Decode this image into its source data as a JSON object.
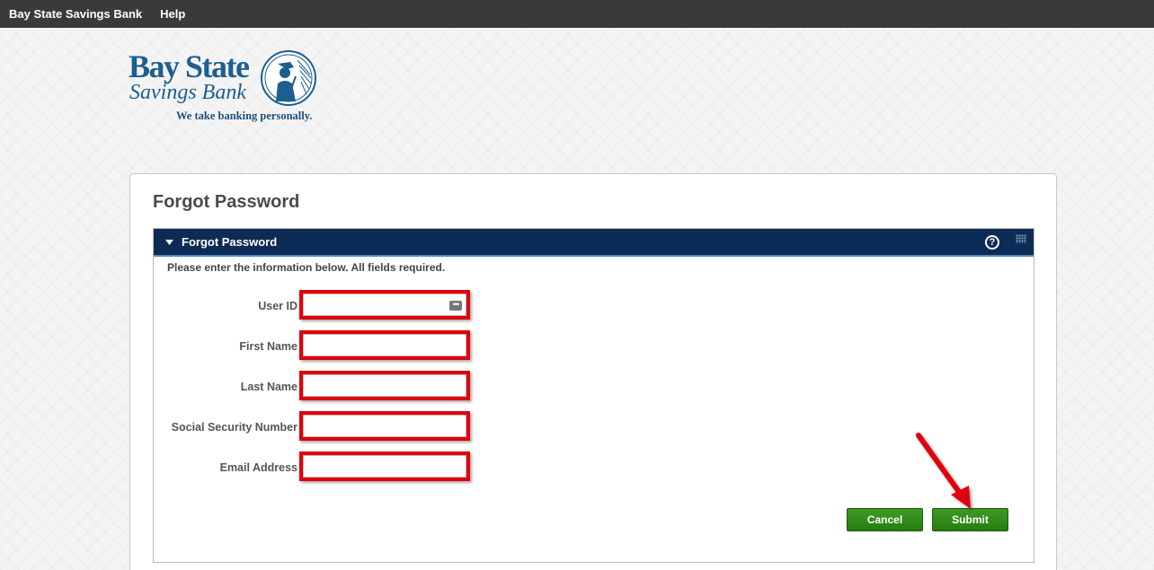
{
  "nav": {
    "items": [
      {
        "label": "Bay State Savings Bank"
      },
      {
        "label": "Help"
      }
    ]
  },
  "logo": {
    "line1": "Bay State",
    "line2": "Savings Bank",
    "tagline": "We take banking personally."
  },
  "card": {
    "title": "Forgot Password"
  },
  "panel": {
    "title": "Forgot Password",
    "help_icon": "help-circle-icon",
    "instructions": "Please enter the information below. All fields required."
  },
  "form": {
    "fields": [
      {
        "label": "User ID",
        "value": ""
      },
      {
        "label": "First Name",
        "value": ""
      },
      {
        "label": "Last Name",
        "value": ""
      },
      {
        "label": "Social Security Number",
        "value": ""
      },
      {
        "label": "Email Address",
        "value": ""
      }
    ]
  },
  "buttons": {
    "cancel": "Cancel",
    "submit": "Submit"
  },
  "colors": {
    "topbar": "#3a3a3a",
    "panel_header": "#0d2c55",
    "button_green": "#2e8a17",
    "highlight_red": "#e0000b",
    "brand_blue": "#1d5e8f"
  }
}
